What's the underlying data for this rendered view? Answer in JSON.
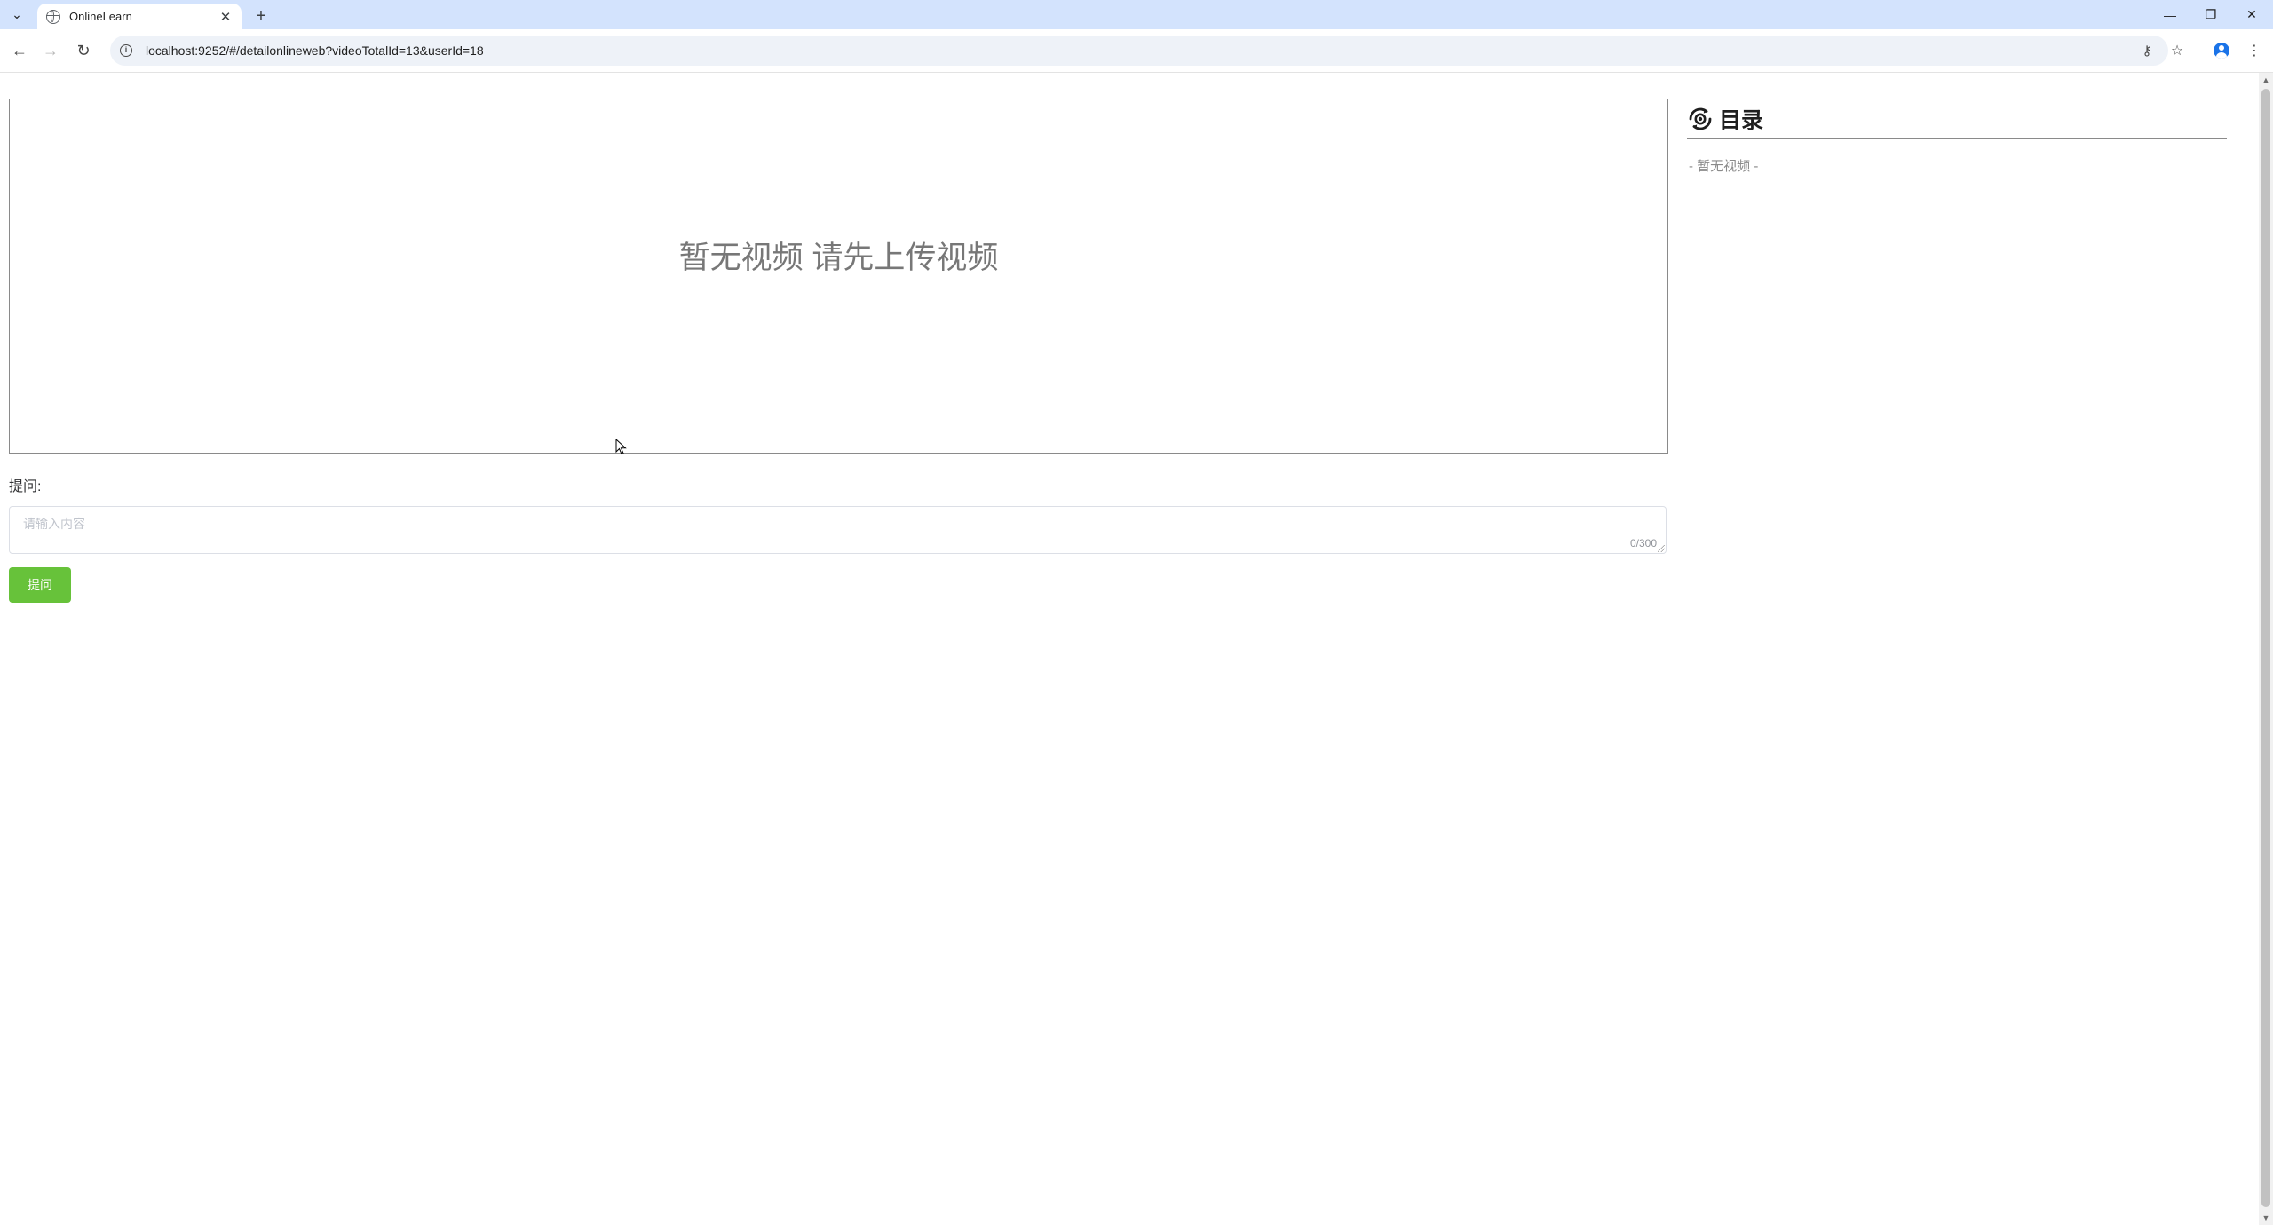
{
  "browser": {
    "tab_title": "OnlineLearn",
    "url": "localhost:9252/#/detailonlineweb?videoTotalId=13&userId=18",
    "icons": {
      "tab_search": "chevron-down-icon",
      "favicon": "globe-icon",
      "tab_close": "close-icon",
      "new_tab": "plus-icon",
      "minimize": "minimize-icon",
      "restore": "restore-icon",
      "close_window": "close-icon",
      "back": "arrow-left-icon",
      "forward": "arrow-right-icon",
      "reload": "reload-icon",
      "site_info": "info-icon",
      "password": "key-icon",
      "bookmark": "star-icon",
      "profile": "profile-icon",
      "menu": "kebab-menu-icon"
    },
    "glyphs": {
      "tab_search": "⌄",
      "tab_close": "✕",
      "new_tab": "+",
      "minimize": "—",
      "restore": "❐",
      "close_window": "✕",
      "back": "←",
      "forward": "→",
      "reload": "↻",
      "site_info": "i",
      "password": "⚷",
      "bookmark": "☆",
      "menu": "⋮"
    }
  },
  "video": {
    "placeholder_message": "暂无视频 请先上传视频"
  },
  "question": {
    "label": "提问:",
    "placeholder": "请输入内容",
    "counter": "0/300",
    "button_label": "提问"
  },
  "catalog": {
    "title": "目录",
    "icon": "eye-rotate-icon",
    "empty_text": "- 暂无视频 -"
  },
  "colors": {
    "tabstrip_bg": "#d3e3fd",
    "omnibox_bg": "#eef2f8",
    "primary_button": "#67c23a",
    "profile_accent": "#1a73e8"
  }
}
